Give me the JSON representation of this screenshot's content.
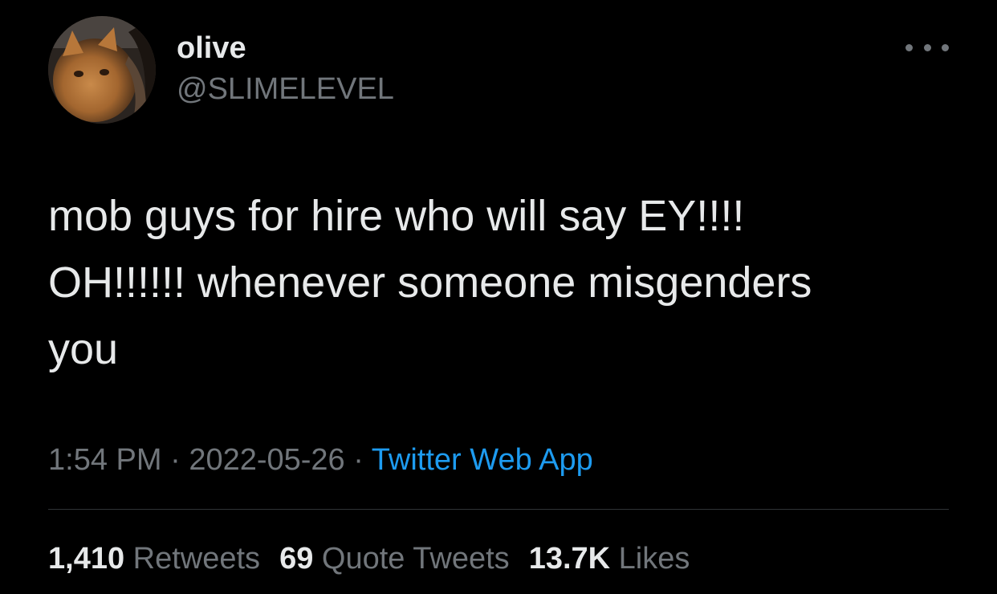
{
  "author": {
    "display_name": "olive",
    "handle": "@SLIMELEVEL",
    "avatar_icon": "cat-photo-avatar"
  },
  "tweet": {
    "text": "mob guys for hire who will say EY!!!!\nOH!!!!!! whenever someone misgenders\nyou"
  },
  "meta": {
    "time": "1:54 PM",
    "separator": " · ",
    "date": "2022-05-26",
    "source": "Twitter Web App"
  },
  "stats": {
    "retweets_count": "1,410",
    "retweets_label": "Retweets",
    "quotes_count": "69",
    "quotes_label": "Quote Tweets",
    "likes_count": "13.7K",
    "likes_label": "Likes"
  },
  "colors": {
    "background": "#000000",
    "primary_text": "#e7e9ea",
    "secondary_text": "#71767b",
    "link": "#1d9bf0",
    "divider": "#2f3336"
  },
  "icons": {
    "more": "more-dots-icon"
  }
}
